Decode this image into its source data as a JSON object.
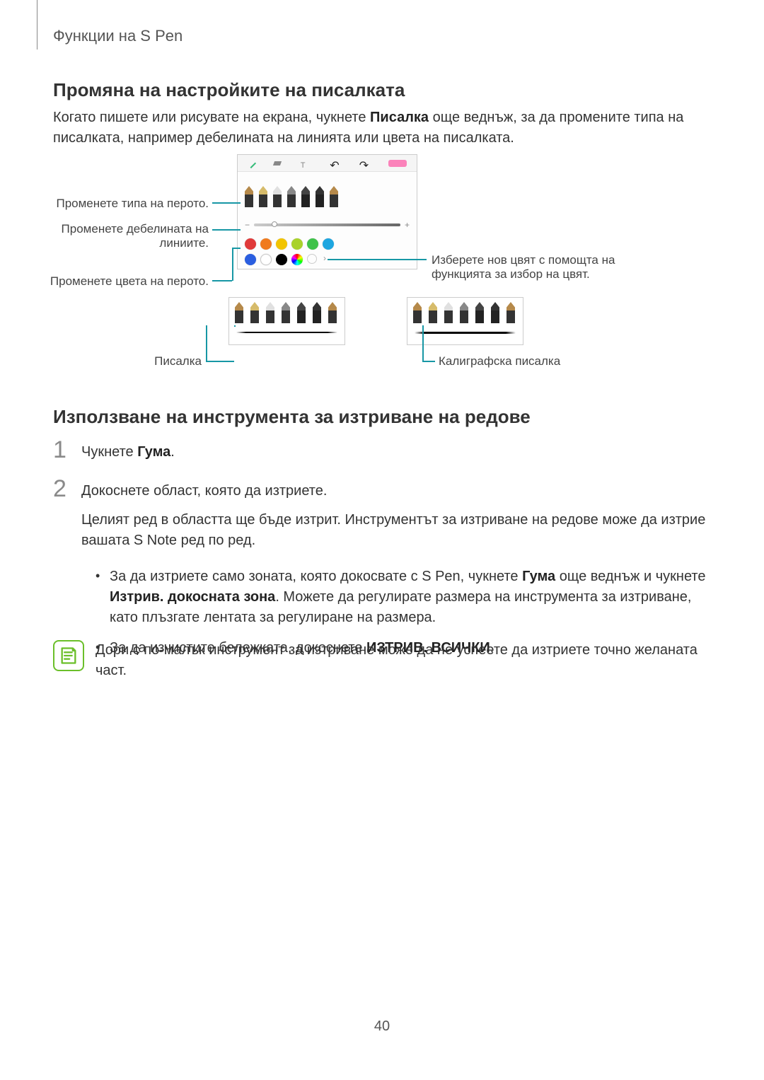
{
  "header": {
    "section": "Функции на S Pen"
  },
  "heading1": "Промяна на настройките на писалката",
  "intro": {
    "pre": "Когато пишете или рисувате на екрана, чукнете ",
    "bold": "Писалка",
    "post": " още веднъж, за да промените типа на писалката, например дебелината на линията или цвета на писалката."
  },
  "callouts": {
    "type": "Променете типа на перото.",
    "thickness1": "Променете дебелината на",
    "thickness2": "линиите.",
    "color": "Променете цвета на перото.",
    "picker1": "Изберете нов цвят с помощта на",
    "picker2": "функцията за избор на цвят.",
    "pen": "Писалка",
    "calligraphy": "Калиграфска писалка"
  },
  "heading2": "Използване на инструмента за изтриване на редове",
  "step1": {
    "num": "1",
    "pre": "Чукнете ",
    "bold": "Гума",
    "post": "."
  },
  "step2": {
    "num": "2",
    "line1": "Докоснете област, която да изтриете.",
    "line2": "Целият ред в областта ще бъде изтрит. Инструментът за изтриване на редове може да изтрие вашата S Note ред по ред."
  },
  "bullets": {
    "b1_pre": "За да изтриете само зоната, която докосвате с S Pen, чукнете ",
    "b1_b1": "Гума",
    "b1_mid": " още веднъж и чукнете ",
    "b1_b2": "Изтрив. докосната зона",
    "b1_post": ". Можете да регулирате размера на инструмента за изтриване, като плъзгате лентата за регулиране на размера.",
    "b2_pre": "За да изчистите бележката, докоснете ",
    "b2_b": "ИЗТРИВ. ВСИЧКИ",
    "b2_post": "."
  },
  "note": "Дори с по-малък инструмент за изтриване може да не успеете да изтриете точно желаната част.",
  "page": "40",
  "palette": {
    "row1": [
      "#e03a3a",
      "#f07b1e",
      "#f2c400",
      "#a9d22a",
      "#3fc24a",
      "#1ea6e0"
    ],
    "row2": [
      "#2a5ee0",
      "#fff",
      "#000",
      "#e040c0"
    ]
  }
}
